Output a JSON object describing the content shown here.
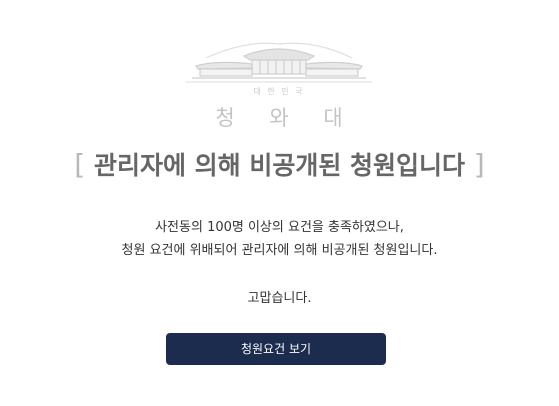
{
  "logo": {
    "subtitle": "대 한 민 국",
    "name": "청 와 대",
    "color": "#c9c9c9"
  },
  "title": {
    "open_bracket": "[",
    "text": "관리자에 의해 비공개된 청원입니다",
    "close_bracket": "]"
  },
  "message": {
    "line1": "사전동의 100명 이상의 요건을 충족하였으나,",
    "line2": "청원 요건에 위배되어 관리자에 의해 비공개된 청원입니다."
  },
  "thanks": "고맙습니다.",
  "button": {
    "label": "청원요건 보기",
    "color": "#1b2c4f"
  }
}
